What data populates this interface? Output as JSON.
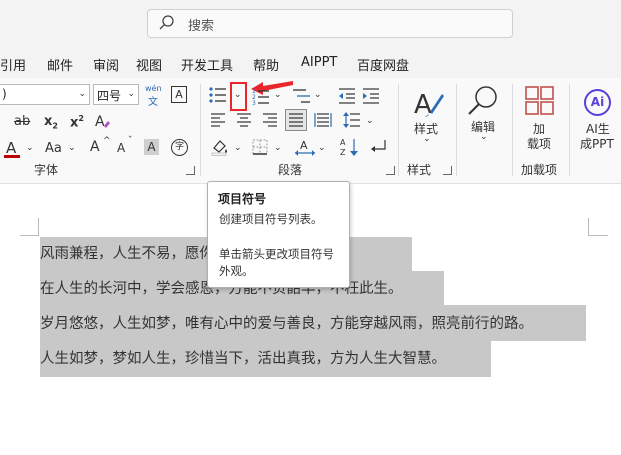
{
  "search": {
    "placeholder": "搜索"
  },
  "menu": [
    "引用",
    "邮件",
    "审阅",
    "视图",
    "开发工具",
    "帮助",
    "AIPPT",
    "百度网盘"
  ],
  "ribbon": {
    "font_combo_value": ")",
    "size_combo_value": "四号",
    "wen_top": "wén",
    "wen_bottom": "文",
    "format_a": "A",
    "groups": {
      "font": "字体",
      "paragraph": "段落",
      "styles": "样式",
      "addins": "加载项"
    },
    "styles_button": "样式",
    "edit_button": "编辑",
    "addin_button_line1": "加",
    "addin_button_line2": "载项",
    "ai_button_line1": "AI生",
    "ai_button_line2": "成PPT",
    "ai_logo": "Ai",
    "font_glyphs": {
      "ab": "ab",
      "x2sub": "x",
      "sub2": "2",
      "x2sup": "x",
      "sup2": "2",
      "a_color": "A",
      "aa": "Aa",
      "grow": "A",
      "shrink": "A",
      "shade": "A",
      "circle": "字"
    }
  },
  "tooltip": {
    "title": "项目符号",
    "line1": "创建项目符号列表。",
    "line2": "单击箭头更改项目符号",
    "line3": "外观。"
  },
  "document": {
    "paragraphs": [
      "风雨兼程，人生不易，愿你我都能温暖人心。",
      "在人生的长河中，学会感恩，方能不负韶华，不枉此生。",
      "岁月悠悠，人生如梦，唯有心中的爱与善良，方能穿越风雨，照亮前行的路。",
      "人生如梦，梦如人生，珍惜当下，活出真我，方为人生大智慧。"
    ]
  },
  "colors": {
    "highlight": "#c8c8c8",
    "red": "#e8262b",
    "accent": "#c0504d",
    "ai_purple": "#5b3fd6"
  }
}
